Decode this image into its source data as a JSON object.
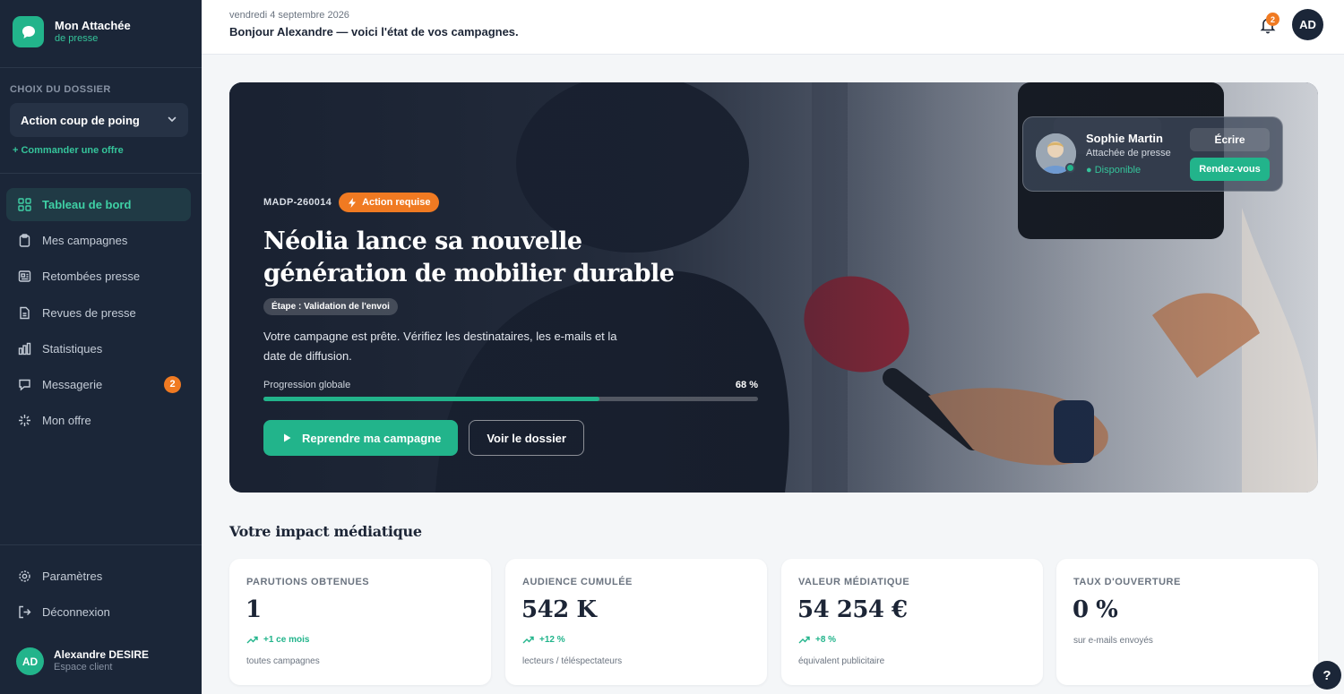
{
  "brand": {
    "title": "Mon Attachée",
    "subtitle": "de presse"
  },
  "sidebar": {
    "folder_label": "CHOIX DU DOSSIER",
    "folder_selected": "Action coup de poing",
    "order_link": "+ Commander une offre",
    "items": [
      {
        "label": "Tableau de bord",
        "icon": "grid-icon",
        "active": true
      },
      {
        "label": "Mes campagnes",
        "icon": "clipboard-icon"
      },
      {
        "label": "Retombées presse",
        "icon": "newspaper-icon"
      },
      {
        "label": "Revues de presse",
        "icon": "document-icon"
      },
      {
        "label": "Statistiques",
        "icon": "bar-chart-icon"
      },
      {
        "label": "Messagerie",
        "icon": "chat-icon",
        "badge": "2"
      },
      {
        "label": "Mon offre",
        "icon": "sparkle-icon"
      }
    ],
    "bottom_items": [
      {
        "label": "Paramètres",
        "icon": "gear-icon"
      },
      {
        "label": "Déconnexion",
        "icon": "logout-icon"
      }
    ],
    "user": {
      "initials": "AD",
      "name": "Alexandre DESIRE",
      "role": "Espace client"
    }
  },
  "header": {
    "date": "vendredi 4 septembre 2026",
    "greeting": "Bonjour Alexandre — voici l'état de vos campagnes.",
    "notifications_count": "2",
    "avatar_initials": "AD"
  },
  "hero": {
    "ref": "MADP-260014",
    "badge": "Action requise",
    "title": "Néolia lance sa nouvelle génération de mobilier durable",
    "step": "Étape : Validation de l'envoi",
    "description": "Votre campagne est prête. Vérifiez les destinataires, les e-mails et la date de diffusion.",
    "progress_label": "Progression globale",
    "progress_text": "68 %",
    "progress_value": 68,
    "primary_button": "Reprendre ma campagne",
    "secondary_button": "Voir le dossier"
  },
  "contact": {
    "name": "Sophie Martin",
    "role": "Attachée de presse",
    "status": "● Disponible",
    "write_button": "Écrire",
    "meet_button": "Rendez-vous"
  },
  "impact": {
    "title": "Votre impact médiatique",
    "cards": [
      {
        "label": "PARUTIONS OBTENUES",
        "value": "1",
        "trend": "+1 ce mois",
        "note": "toutes campagnes"
      },
      {
        "label": "AUDIENCE CUMULÉE",
        "value": "542 K",
        "trend": "+12 %",
        "note": "lecteurs / téléspectateurs"
      },
      {
        "label": "VALEUR MÉDIATIQUE",
        "value": "54 254 €",
        "trend": "+8 %",
        "note": "équivalent publicitaire"
      },
      {
        "label": "TAUX D'OUVERTURE",
        "value": "0 %",
        "note": "sur e-mails envoyés"
      }
    ]
  },
  "help": "?",
  "colors": {
    "accent": "#22b48b",
    "sidebar": "#1b2638",
    "warning": "#f07a22"
  }
}
